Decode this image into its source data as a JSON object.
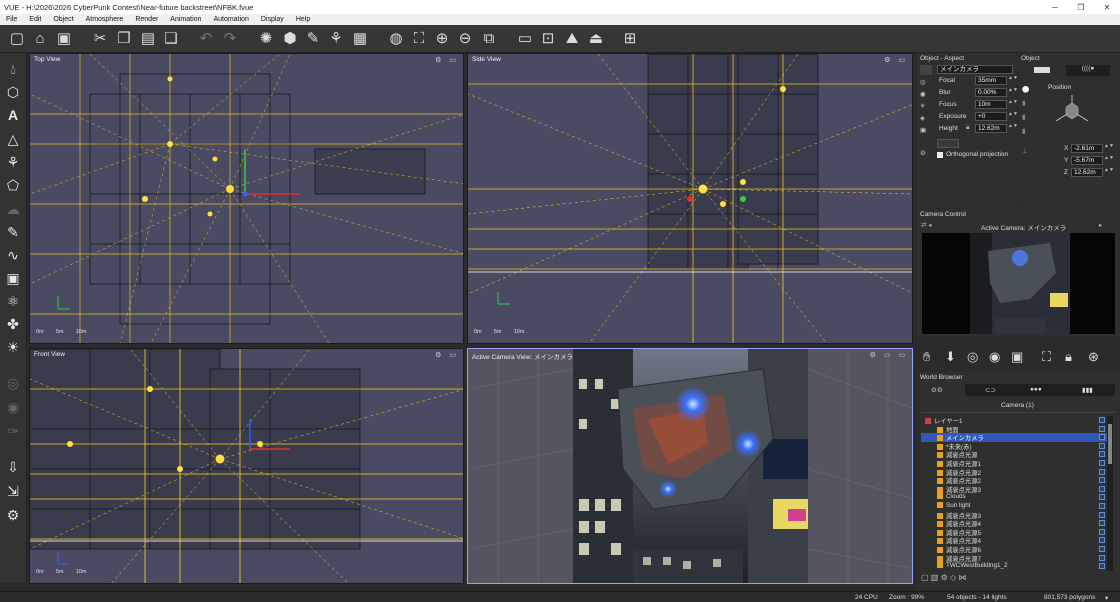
{
  "window": {
    "title": "VUE - H:\\2026\\2026 CyberPunk Contest\\Near-future backstreet\\NFBK.fvue",
    "minimize": "─",
    "maximize": "❐",
    "close": "✕"
  },
  "menu": [
    "File",
    "Edit",
    "Object",
    "Atmosphere",
    "Render",
    "Animation",
    "Automation",
    "Display",
    "Help"
  ],
  "toolbar_icons": [
    "new-file-icon",
    "open-folder-icon",
    "save-icon",
    "cut-icon",
    "copy-icon",
    "paste-icon",
    "duplicate-icon",
    "undo-icon",
    "redo-icon",
    "light-icon",
    "object-icon",
    "brush-icon",
    "material-icon",
    "film-icon",
    "globe-icon",
    "frame-all-icon",
    "zoom-in-icon",
    "zoom-out-icon",
    "fit-icon",
    "render-icon",
    "render-area-icon",
    "render-landscape-icon",
    "render-preview-icon",
    "layout-icon"
  ],
  "left_tools": [
    "water-icon",
    "cube-icon",
    "text-icon",
    "terrain-icon",
    "plant-icon",
    "rock-icon",
    "cloud-icon",
    "paint-icon",
    "curve-icon",
    "box-icon",
    "molecule-icon",
    "ecosystem-icon",
    "sun-icon",
    "atmo-icon",
    "camera-tool-icon",
    "wrench-icon",
    "import-icon",
    "export-icon",
    "gear-tool-icon"
  ],
  "viewports": {
    "top": {
      "label": "Top View",
      "scale": [
        "0m",
        "5m",
        "10m"
      ]
    },
    "side": {
      "label": "Side View",
      "scale": [
        "0m",
        "5m",
        "10m"
      ]
    },
    "front": {
      "label": "Front View",
      "scale": [
        "0m",
        "5m",
        "10m"
      ]
    },
    "camera": {
      "label": "Active Camera View: メインカメラ"
    }
  },
  "aspect_panel": {
    "title": "Object - Aspect",
    "camera_name": "メインカメラ",
    "fields": [
      {
        "label": "Focal",
        "value": "35mm"
      },
      {
        "label": "Blur",
        "value": "0.00%"
      },
      {
        "label": "Focus",
        "value": "10m"
      },
      {
        "label": "Exposure",
        "value": "+0"
      },
      {
        "label": "Height",
        "value": "12.62m"
      }
    ],
    "orthographic_label": "Orthogonal projection"
  },
  "object_panel": {
    "title": "Object",
    "position_label": "Position",
    "coords": [
      {
        "axis": "X",
        "value": "-2.61m"
      },
      {
        "axis": "Y",
        "value": "-5.67m"
      },
      {
        "axis": "Z",
        "value": "12.62m"
      }
    ]
  },
  "camera_control": {
    "title": "Camera Control",
    "active_camera": "Active Camera: メインカメラ"
  },
  "world_browser": {
    "title": "World Browser",
    "filter_label": "Camera (1)",
    "items": [
      {
        "label": "レイヤー1",
        "indent": 0,
        "selected": false
      },
      {
        "label": "地面",
        "indent": 1,
        "selected": false
      },
      {
        "label": "メインカメラ",
        "indent": 1,
        "selected": true
      },
      {
        "label": "*未来(赤)",
        "indent": 1,
        "selected": false
      },
      {
        "label": "減衰点光源",
        "indent": 1,
        "selected": false
      },
      {
        "label": "減衰点光源1",
        "indent": 1,
        "selected": false
      },
      {
        "label": "減衰点光源2",
        "indent": 1,
        "selected": false
      },
      {
        "label": "減衰点光源2",
        "indent": 1,
        "selected": false
      },
      {
        "label": "減衰点光源3",
        "indent": 1,
        "selected": false
      },
      {
        "label": "Clouds",
        "indent": 1,
        "selected": false
      },
      {
        "label": "Sun light",
        "indent": 1,
        "selected": false
      },
      {
        "label": "減衰点光源3",
        "indent": 1,
        "selected": false
      },
      {
        "label": "減衰点光源4",
        "indent": 1,
        "selected": false
      },
      {
        "label": "減衰点光源5",
        "indent": 1,
        "selected": false
      },
      {
        "label": "減衰点光源4",
        "indent": 1,
        "selected": false
      },
      {
        "label": "減衰点光源6",
        "indent": 1,
        "selected": false
      },
      {
        "label": "減衰点光源7",
        "indent": 1,
        "selected": false
      },
      {
        "label": "TWCWestBuilding1_2",
        "indent": 1,
        "selected": false
      }
    ]
  },
  "status": {
    "cpu": "24 CPU",
    "zoom": "Zoom : 99%",
    "objects": "54 objects - 14 lights",
    "polygons": "801,573 polygons"
  },
  "colors": {
    "viewport_bg": "#4a4b62",
    "wire_yellow": "#ffd21a",
    "selection_blue": "#3157b8"
  }
}
